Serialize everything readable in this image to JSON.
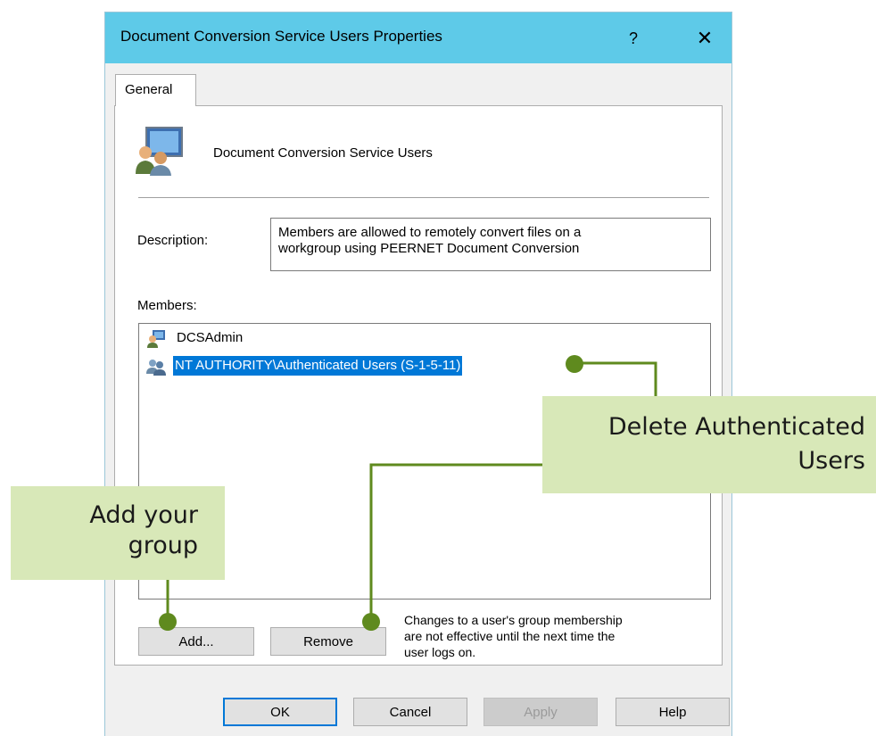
{
  "window": {
    "title": "Document Conversion Service Users Properties",
    "help_glyph": "?",
    "close_glyph": "✕"
  },
  "tabs": [
    {
      "label": "General"
    }
  ],
  "group": {
    "name": "Document Conversion Service Users"
  },
  "description": {
    "label": "Description:",
    "value_line1": "Members are allowed to remotely convert files on a",
    "value_line2": "workgroup using PEERNET Document Conversion"
  },
  "members": {
    "label": "Members:",
    "items": [
      {
        "name": "DCSAdmin",
        "icon": "user-icon",
        "selected": false
      },
      {
        "name": "NT AUTHORITY\\Authenticated Users (S-1-5-11)",
        "icon": "group-icon",
        "selected": true
      }
    ]
  },
  "buttons": {
    "add": "Add...",
    "remove": "Remove",
    "ok": "OK",
    "cancel": "Cancel",
    "apply": "Apply",
    "help": "Help"
  },
  "note": {
    "line1": "Changes to a user's group membership",
    "line2": "are not effective until the next time the",
    "line3": "user logs on."
  },
  "callouts": {
    "add": {
      "line1": "Add your",
      "line2": "group"
    },
    "delete": {
      "line1": "Delete Authenticated",
      "line2": "Users"
    }
  },
  "colors": {
    "titlebar": "#5ecae8",
    "selection": "#0078d7",
    "callout_bg": "#d8e8b8",
    "callout_line": "#5f8a1e"
  }
}
